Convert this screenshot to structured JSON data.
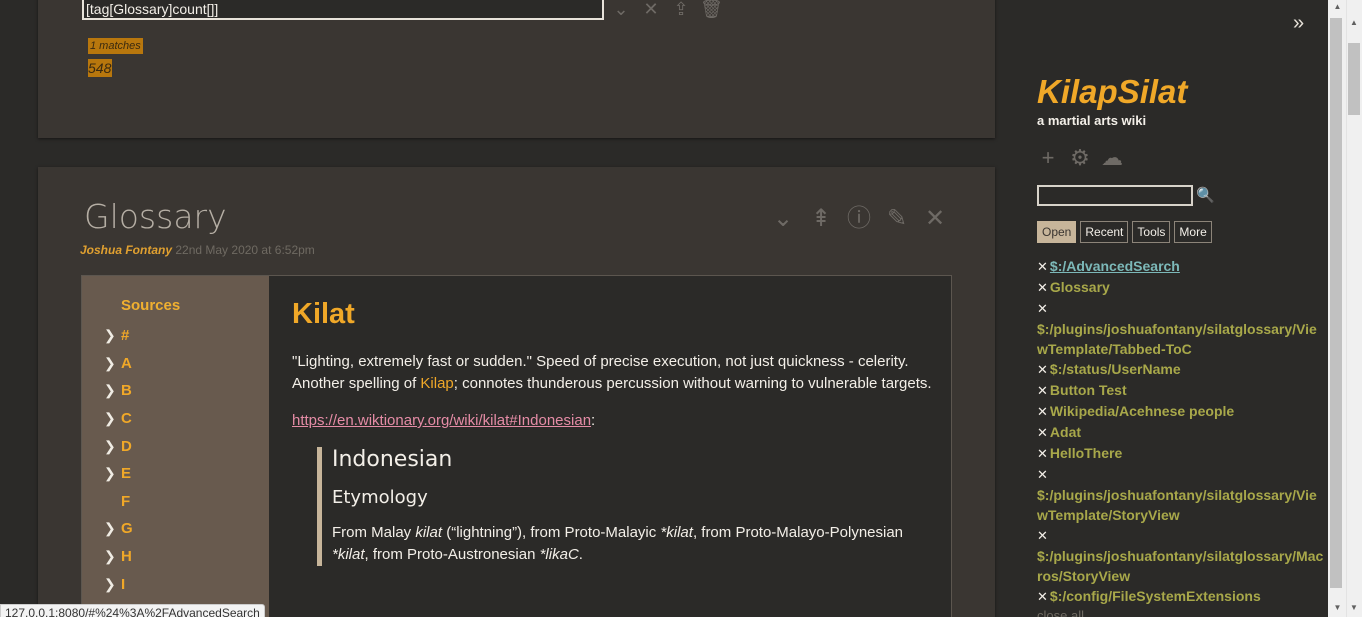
{
  "search": {
    "value": "[tag[Glossary]count[]]"
  },
  "results": {
    "matches": "1 matches",
    "count": "548"
  },
  "tiddler": {
    "title": "Glossary",
    "author": "Joshua Fontany",
    "date": "22nd May 2020 at 6:52pm"
  },
  "toc": {
    "heading": "Sources",
    "items": [
      "#",
      "A",
      "B",
      "C",
      "D",
      "E",
      "F",
      "G",
      "H",
      "I"
    ]
  },
  "entry": {
    "title": "Kilat",
    "para1_a": "\"Lighting, extremely fast or sudden.\" Speed of precise execution, not just quickness - celerity. Another spelling of ",
    "para1_link": "Kilap",
    "para1_b": "; connotes thunderous percussion without warning to vulnerable targets.",
    "ext_link": "https://en.wiktionary.org/wiki/kilat#Indonesian",
    "ext_suffix": ":",
    "quote_h2": "Indonesian",
    "quote_h3": "Etymology",
    "quote_text_1": "From Malay ",
    "quote_kilat1": "kilat",
    "quote_text_2": " (“lightning”), from Proto-Malayic ",
    "quote_kilat2": "*kilat",
    "quote_text_3": ", from Proto-Malayo-Polynesian ",
    "quote_kilat3": "*kilat",
    "quote_text_4": ", from Proto-Austronesian ",
    "quote_likac": "*likaC",
    "quote_text_5": "."
  },
  "statusbar": "127.0.0.1:8080/#%24%3A%2FAdvancedSearch",
  "sidebar": {
    "title": "KilapSilat",
    "subtitle": "a martial arts wiki",
    "tabs": [
      "Open",
      "Recent",
      "Tools",
      "More"
    ],
    "open_items": [
      "$:/AdvancedSearch",
      "Glossary",
      "$:/plugins/joshuafontany/silatglossary/ViewTemplate/Tabbed-ToC",
      "$:/status/UserName",
      "Button Test",
      "Wikipedia/Acehnese people",
      "Adat",
      "HelloThere",
      "$:/plugins/joshuafontany/silatglossary/ViewTemplate/StoryView",
      "$:/plugins/joshuafontany/silatglossary/Macros/StoryView",
      "$:/config/FileSystemExtensions"
    ],
    "close_all": "close all"
  },
  "colors": {
    "accent": "#f0a828",
    "background": "#2b2a28",
    "tiddler": "#3a3632",
    "toc": "#685a4e"
  }
}
